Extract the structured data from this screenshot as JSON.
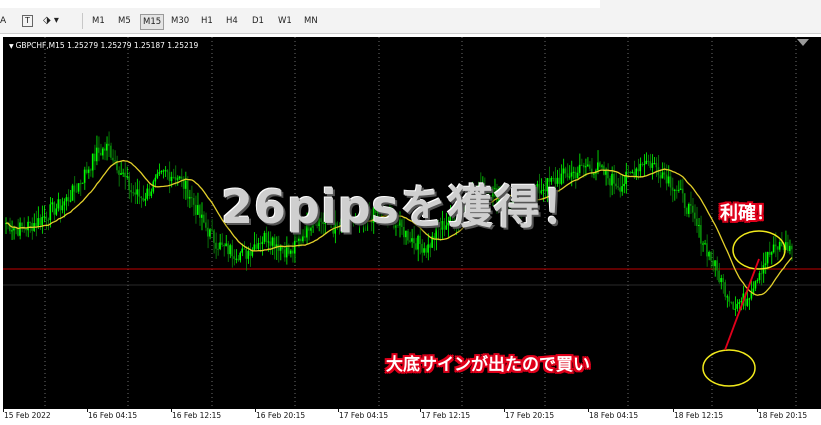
{
  "toolbar": {
    "tools": [
      "A",
      "T"
    ],
    "timeframes": [
      "M1",
      "M5",
      "M15",
      "M30",
      "H1",
      "H4",
      "D1",
      "W1",
      "MN"
    ],
    "active_timeframe": "M15"
  },
  "chart": {
    "symbol_line": "GBPCHF,M15  1.25279 1.25279 1.25187 1.25219",
    "colors": {
      "background": "#000000",
      "bull": "#00ff00",
      "bear": "#0a8a0a",
      "ma": "#e3d02a",
      "hline": "#c00000",
      "grid": "#9a9a9a",
      "annotation": "#e0001b",
      "circle": "#f2ea1c"
    }
  },
  "overlay": {
    "title": "26pipsを獲得！",
    "take_profit": "利確！",
    "buy_note": "大底サインが出たので買い"
  },
  "chart_data": {
    "type": "candlestick",
    "x_labels": [
      "15 Feb 2022",
      "16 Feb 04:15",
      "16 Feb 12:15",
      "16 Feb 20:15",
      "17 Feb 04:15",
      "17 Feb 12:15",
      "17 Feb 20:15",
      "18 Feb 04:15",
      "18 Feb 12:15",
      "18 Feb 20:15"
    ],
    "close_profile": [
      0.62,
      0.6,
      0.61,
      0.63,
      0.66,
      0.68,
      0.72,
      0.78,
      0.84,
      0.86,
      0.79,
      0.72,
      0.7,
      0.74,
      0.78,
      0.77,
      0.72,
      0.64,
      0.58,
      0.54,
      0.53,
      0.52,
      0.56,
      0.58,
      0.55,
      0.52,
      0.58,
      0.64,
      0.62,
      0.6,
      0.63,
      0.61,
      0.64,
      0.66,
      0.63,
      0.59,
      0.56,
      0.54,
      0.6,
      0.63,
      0.66,
      0.7,
      0.74,
      0.71,
      0.69,
      0.67,
      0.7,
      0.73,
      0.75,
      0.77,
      0.78,
      0.8,
      0.79,
      0.76,
      0.74,
      0.78,
      0.82,
      0.8,
      0.77,
      0.72,
      0.66,
      0.58,
      0.5,
      0.42,
      0.36,
      0.38,
      0.46,
      0.52,
      0.55,
      0.54
    ]
  }
}
